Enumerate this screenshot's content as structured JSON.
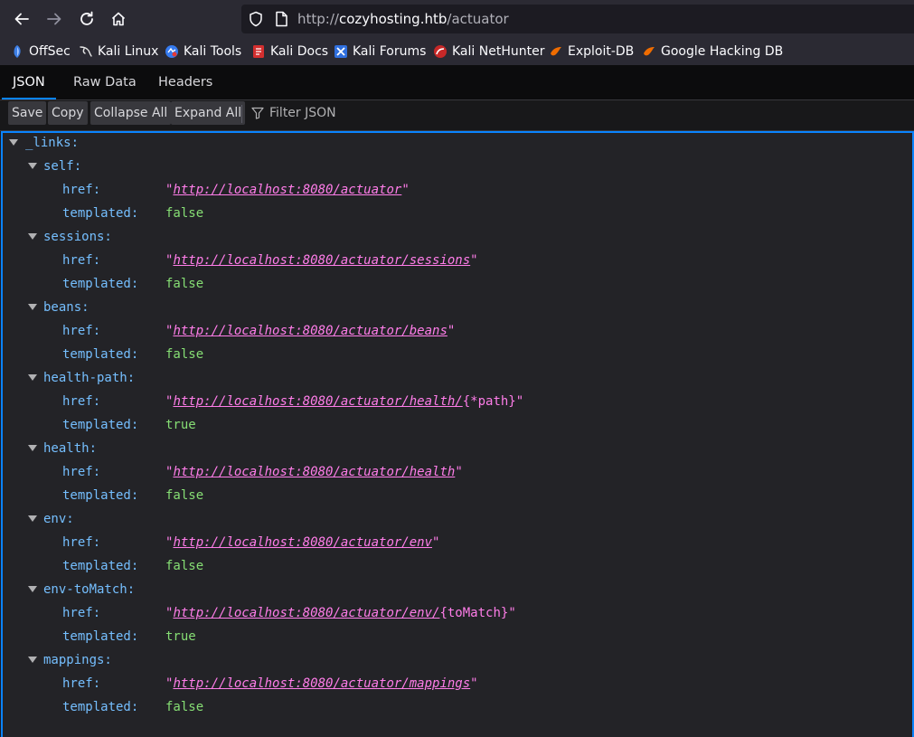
{
  "browser": {
    "url_proto": "http://",
    "url_host": "cozyhosting.htb",
    "url_path": "/actuator"
  },
  "bookmarks": [
    {
      "label": "OffSec",
      "icon": "offsec-icon"
    },
    {
      "label": "Kali Linux",
      "icon": "kali-dragon-icon"
    },
    {
      "label": "Kali Tools",
      "icon": "kali-tools-icon"
    },
    {
      "label": "Kali Docs",
      "icon": "kali-docs-icon"
    },
    {
      "label": "Kali Forums",
      "icon": "kali-forums-icon"
    },
    {
      "label": "Kali NetHunter",
      "icon": "nethunter-icon"
    },
    {
      "label": "Exploit-DB",
      "icon": "exploitdb-icon"
    },
    {
      "label": "Google Hacking DB",
      "icon": "ghdb-icon"
    }
  ],
  "viewer_tabs": [
    "JSON",
    "Raw Data",
    "Headers"
  ],
  "toolbar": {
    "save": "Save",
    "copy": "Copy",
    "collapse_all": "Collapse All",
    "expand_all": "Expand All",
    "filter_placeholder": "Filter JSON"
  },
  "tree": {
    "root_key": "_links:",
    "href_label": "href:",
    "templated_label": "templated:",
    "entries": [
      {
        "key": "self:",
        "href": "http://localhost:8080/actuator",
        "href_tail": "",
        "templated": "false"
      },
      {
        "key": "sessions:",
        "href": "http://localhost:8080/actuator/sessions",
        "href_tail": "",
        "templated": "false"
      },
      {
        "key": "beans:",
        "href": "http://localhost:8080/actuator/beans",
        "href_tail": "",
        "templated": "false"
      },
      {
        "key": "health-path:",
        "href": "http://localhost:8080/actuator/health/",
        "href_tail": "{*path}",
        "templated": "true"
      },
      {
        "key": "health:",
        "href": "http://localhost:8080/actuator/health",
        "href_tail": "",
        "templated": "false"
      },
      {
        "key": "env:",
        "href": "http://localhost:8080/actuator/env",
        "href_tail": "",
        "templated": "false"
      },
      {
        "key": "env-toMatch:",
        "href": "http://localhost:8080/actuator/env/",
        "href_tail": "{toMatch}",
        "templated": "true"
      },
      {
        "key": "mappings:",
        "href": "http://localhost:8080/actuator/mappings",
        "href_tail": "",
        "templated": "false"
      }
    ]
  }
}
